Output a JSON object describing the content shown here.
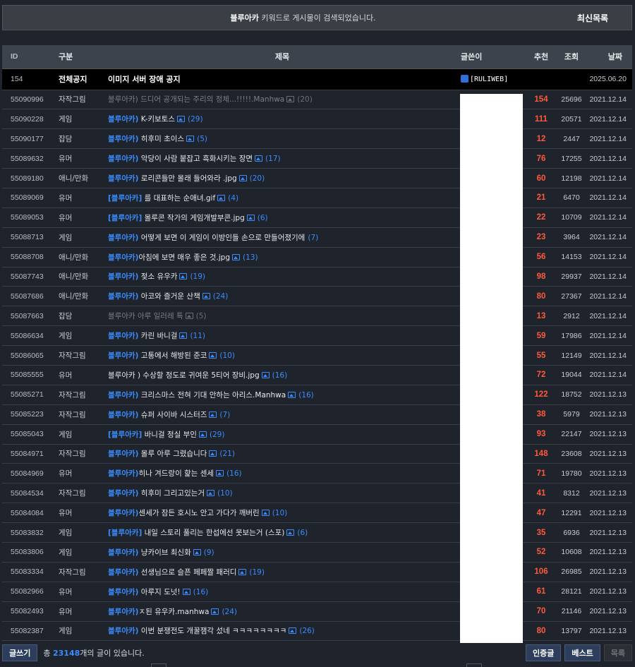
{
  "search_bar": {
    "keyword": "블루아카",
    "message": " 키워드로 게시물이 검색되었습니다.",
    "latest_label": "최신목록"
  },
  "columns": [
    "ID",
    "구분",
    "제목",
    "글쓴이",
    "추천",
    "조회",
    "날짜"
  ],
  "notice": {
    "id": "154",
    "category": "전체공지",
    "title": "이미지 서버 장애 공지",
    "writer": "[RULIWEB]",
    "date": "2025.06.20"
  },
  "rows": [
    {
      "id": "55090996",
      "cat": "자작그림",
      "kw": "블루아카)",
      "title": " 드디어 공개되는 주리의 정체...!!!!!.Manhwa",
      "img": true,
      "comments": "(20)",
      "rec": "154",
      "views": "25696",
      "date": "2021.12.14",
      "dim": true
    },
    {
      "id": "55090228",
      "cat": "게임",
      "kw": "블루아카)",
      "title": " K-키보토스",
      "img": true,
      "comments": "(29)",
      "rec": "111",
      "views": "20571",
      "date": "2021.12.14",
      "dim": false
    },
    {
      "id": "55090177",
      "cat": "잡담",
      "kw": "블루아카)",
      "title": " 히후미 초이스",
      "img": true,
      "comments": "(5)",
      "rec": "12",
      "views": "2447",
      "date": "2021.12.14",
      "dim": false
    },
    {
      "id": "55089632",
      "cat": "유머",
      "kw": "블루아카)",
      "title": " 악당이 사람 붙잡고 흑화시키는 장면",
      "img": true,
      "comments": "(17)",
      "rec": "76",
      "views": "17255",
      "date": "2021.12.14",
      "dim": false
    },
    {
      "id": "55089180",
      "cat": "애니/만화",
      "kw": "블루아카)",
      "title": " 로리콘들만 몰래 들어와라 .jpg",
      "img": true,
      "comments": "(20)",
      "rec": "60",
      "views": "12198",
      "date": "2021.12.14",
      "dim": false
    },
    {
      "id": "55089069",
      "cat": "유머",
      "kw": "[블루아카]",
      "title": " 를 대표하는 순애녀.gif",
      "img": true,
      "comments": "(4)",
      "rec": "21",
      "views": "6470",
      "date": "2021.12.14",
      "dim": false
    },
    {
      "id": "55089053",
      "cat": "유머",
      "kw": "[블루아카]",
      "title": " 몰루콘 작가의 게임개발부콘.jpg",
      "img": true,
      "comments": "(6)",
      "rec": "22",
      "views": "10709",
      "date": "2021.12.14",
      "dim": false
    },
    {
      "id": "55088713",
      "cat": "게임",
      "kw": "블루아카)",
      "title": " 어떻게 보면 이 게임이 이방인들 손으로 만들어졌기에",
      "img": false,
      "comments": "(7)",
      "rec": "23",
      "views": "3964",
      "date": "2021.12.14",
      "dim": false
    },
    {
      "id": "55088708",
      "cat": "애니/만화",
      "kw": "블루아카)",
      "title": "아침에 보면 매우 좋은 것.jpg",
      "img": true,
      "comments": "(13)",
      "rec": "56",
      "views": "14153",
      "date": "2021.12.14",
      "dim": false
    },
    {
      "id": "55087743",
      "cat": "애니/만화",
      "kw": "블루아카)",
      "title": " 젖소 유우카",
      "img": true,
      "comments": "(19)",
      "rec": "98",
      "views": "29937",
      "date": "2021.12.14",
      "dim": false
    },
    {
      "id": "55087686",
      "cat": "애니/만화",
      "kw": "블루아카)",
      "title": " 아코와 즐거운 산책",
      "img": true,
      "comments": "(24)",
      "rec": "80",
      "views": "27367",
      "date": "2021.12.14",
      "dim": false
    },
    {
      "id": "55087663",
      "cat": "잡담",
      "kw": "블루아카",
      "title": " 아루 일러레 특",
      "img": true,
      "comments": "(5)",
      "rec": "13",
      "views": "2912",
      "date": "2021.12.14",
      "dim": true
    },
    {
      "id": "55086634",
      "cat": "게임",
      "kw": "블루아카)",
      "title": " 카린 바니걸",
      "img": true,
      "comments": "(11)",
      "rec": "59",
      "views": "17986",
      "date": "2021.12.14",
      "dim": false
    },
    {
      "id": "55086065",
      "cat": "자작그림",
      "kw": "블루아카)",
      "title": " 고통에서 해방된 준코",
      "img": true,
      "comments": "(10)",
      "rec": "55",
      "views": "12149",
      "date": "2021.12.14",
      "dim": false
    },
    {
      "id": "55085555",
      "cat": "유머",
      "kw": "",
      "title": "블루아카 ) 수상할 정도로 귀여운 5티어 장비.jpg",
      "img": true,
      "comments": "(16)",
      "rec": "72",
      "views": "19044",
      "date": "2021.12.14",
      "dim": false
    },
    {
      "id": "55085271",
      "cat": "자작그림",
      "kw": "블루아카)",
      "title": " 크리스마스 전혀 기대 안하는 아리스.Manhwa",
      "img": true,
      "comments": "(16)",
      "rec": "122",
      "views": "18752",
      "date": "2021.12.13",
      "dim": false
    },
    {
      "id": "55085223",
      "cat": "자작그림",
      "kw": "블루아카)",
      "title": " 슈퍼 사이바 시스터즈",
      "img": true,
      "comments": "(7)",
      "rec": "38",
      "views": "5979",
      "date": "2021.12.13",
      "dim": false
    },
    {
      "id": "55085043",
      "cat": "게임",
      "kw": "[블루아카]",
      "title": " 바니걸 정실 부인",
      "img": true,
      "comments": "(29)",
      "rec": "93",
      "views": "22147",
      "date": "2021.12.13",
      "dim": false
    },
    {
      "id": "55084971",
      "cat": "자작그림",
      "kw": "블루아카)",
      "title": " 몰루 아루 그렸습니다",
      "img": true,
      "comments": "(21)",
      "rec": "148",
      "views": "23608",
      "date": "2021.12.13",
      "dim": false
    },
    {
      "id": "55084969",
      "cat": "유머",
      "kw": "블루아카)",
      "title": "히나 겨드랑이 핥는 센세",
      "img": true,
      "comments": "(16)",
      "rec": "71",
      "views": "19780",
      "date": "2021.12.13",
      "dim": false
    },
    {
      "id": "55084534",
      "cat": "자작그림",
      "kw": "블루아카)",
      "title": " 히후미 그리고있는거",
      "img": true,
      "comments": "(10)",
      "rec": "41",
      "views": "8312",
      "date": "2021.12.13",
      "dim": false
    },
    {
      "id": "55084084",
      "cat": "유머",
      "kw": "블루아카)",
      "title": "센세가 잠든 호시노 안고 가다가 깨버린",
      "img": true,
      "comments": "(10)",
      "rec": "47",
      "views": "12291",
      "date": "2021.12.13",
      "dim": false
    },
    {
      "id": "55083832",
      "cat": "게임",
      "kw": "[블루아카]",
      "title": " 내일 스토리 풀리는 한섭에선 못보는거 (스포)",
      "img": true,
      "comments": "(6)",
      "rec": "35",
      "views": "6936",
      "date": "2021.12.13",
      "dim": false
    },
    {
      "id": "55083806",
      "cat": "게임",
      "kw": "블루아카)",
      "title": " 냥카이브 최신화",
      "img": true,
      "comments": "(9)",
      "rec": "52",
      "views": "10608",
      "date": "2021.12.13",
      "dim": false
    },
    {
      "id": "55083334",
      "cat": "자작그림",
      "kw": "블루아카)",
      "title": " 선생님으로 슬픈 페페짤 패러디",
      "img": true,
      "comments": "(19)",
      "rec": "106",
      "views": "26985",
      "date": "2021.12.13",
      "dim": false
    },
    {
      "id": "55082966",
      "cat": "유머",
      "kw": "블루아카)",
      "title": " 아루지 도넛!",
      "img": true,
      "comments": "(16)",
      "rec": "61",
      "views": "28121",
      "date": "2021.12.13",
      "dim": false
    },
    {
      "id": "55082493",
      "cat": "유머",
      "kw": "블루아카)",
      "title": "ㅈ된 유우카.manhwa",
      "img": true,
      "comments": "(24)",
      "rec": "70",
      "views": "21146",
      "date": "2021.12.13",
      "dim": false
    },
    {
      "id": "55082387",
      "cat": "게임",
      "kw": "블루아카)",
      "title": " 이번 분쟁전도 개꿀잼각 섰네 ㅋㅋㅋㅋㅋㅋㅋㅋ",
      "img": true,
      "comments": "(26)",
      "rec": "80",
      "views": "13797",
      "date": "2021.12.13",
      "dim": false
    }
  ],
  "footer": {
    "write_label": "글쓰기",
    "count_prefix": "총 ",
    "count": "23148",
    "count_suffix": "개의 글이 있습니다.",
    "certified_label": "인증글",
    "best_label": "베스트",
    "list_label": "목록"
  }
}
